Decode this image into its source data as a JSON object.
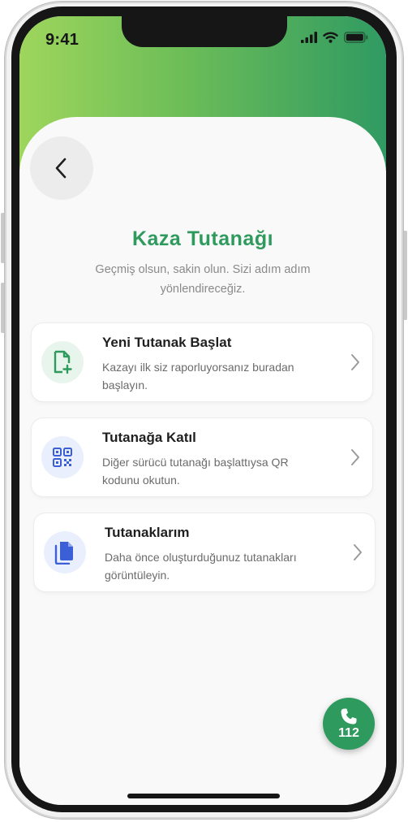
{
  "status_bar": {
    "time": "9:41"
  },
  "header": {
    "title": "Kaza Tutanağı",
    "subtitle": "Geçmiş olsun, sakin olun. Sizi adım adım yönlendireceğiz."
  },
  "cards": [
    {
      "title": "Yeni Tutanak Başlat",
      "description": "Kazayı ilk siz raporluyorsanız buradan başlayın.",
      "icon": "file-add-icon"
    },
    {
      "title": "Tutanağa Katıl",
      "description": "Diğer sürücü tutanağı başlattıysa QR kodunu okutun.",
      "icon": "qr-code-icon"
    },
    {
      "title": "Tutanaklarım",
      "description": "Daha önce oluşturduğunuz tutanakları görüntüleyin.",
      "icon": "documents-icon"
    }
  ],
  "emergency": {
    "number": "112"
  },
  "colors": {
    "brand_green": "#2f9a5d",
    "gradient_light": "#9ed65c",
    "gradient_dark": "#2f9a62",
    "icon_blue": "#3b5fd6"
  }
}
